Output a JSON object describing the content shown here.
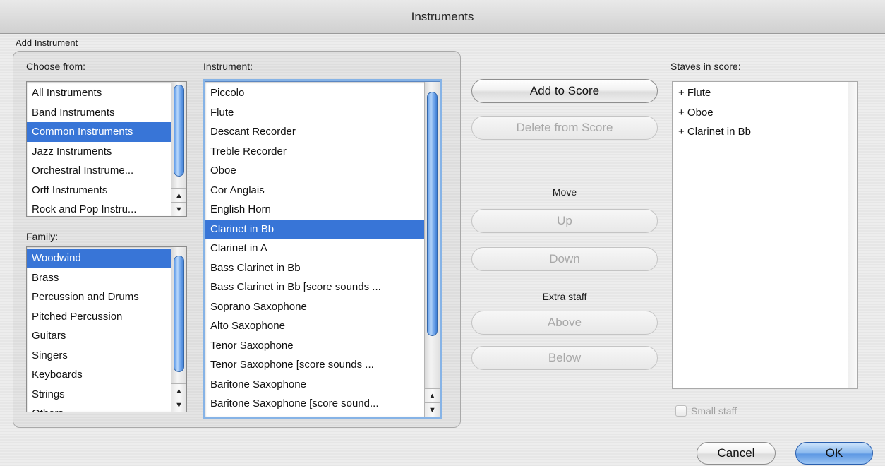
{
  "window": {
    "title": "Instruments"
  },
  "add_instrument": {
    "group_label": "Add Instrument",
    "choose_from": {
      "label": "Choose from:",
      "items": [
        "All Instruments",
        "Band Instruments",
        "Common Instruments",
        "Jazz Instruments",
        "Orchestral Instrume...",
        "Orff Instruments",
        "Rock and Pop Instru..."
      ],
      "selected": "Common Instruments"
    },
    "family": {
      "label": "Family:",
      "items": [
        "Woodwind",
        "Brass",
        "Percussion and Drums",
        "Pitched Percussion",
        "Guitars",
        "Singers",
        "Keyboards",
        "Strings",
        "Others"
      ],
      "selected": "Woodwind"
    },
    "instrument": {
      "label": "Instrument:",
      "items": [
        "Piccolo",
        "Flute",
        "Descant Recorder",
        "Treble Recorder",
        "Oboe",
        "Cor Anglais",
        "English Horn",
        "Clarinet in Bb",
        "Clarinet in A",
        "Bass Clarinet in Bb",
        "Bass Clarinet in Bb [score sounds ...",
        "Soprano Saxophone",
        "Alto Saxophone",
        "Tenor Saxophone",
        "Tenor Saxophone [score sounds ...",
        "Baritone Saxophone",
        "Baritone Saxophone [score sound..."
      ],
      "selected": "Clarinet in Bb"
    }
  },
  "actions": {
    "add_to_score": "Add to Score",
    "delete_from_score": "Delete from Score",
    "move_label": "Move",
    "up": "Up",
    "down": "Down",
    "extra_staff_label": "Extra staff",
    "above": "Above",
    "below": "Below"
  },
  "staves": {
    "label": "Staves in score:",
    "items": [
      "+ Flute",
      "+ Oboe",
      "+ Clarinet in Bb"
    ],
    "small_staff_label": "Small staff",
    "small_staff_checked": false
  },
  "footer": {
    "cancel": "Cancel",
    "ok": "OK"
  },
  "icons": {
    "scroll_up": "▲",
    "scroll_down": "▼"
  },
  "colors": {
    "selection": "#3875d7",
    "default_button": "#5d98e3"
  }
}
